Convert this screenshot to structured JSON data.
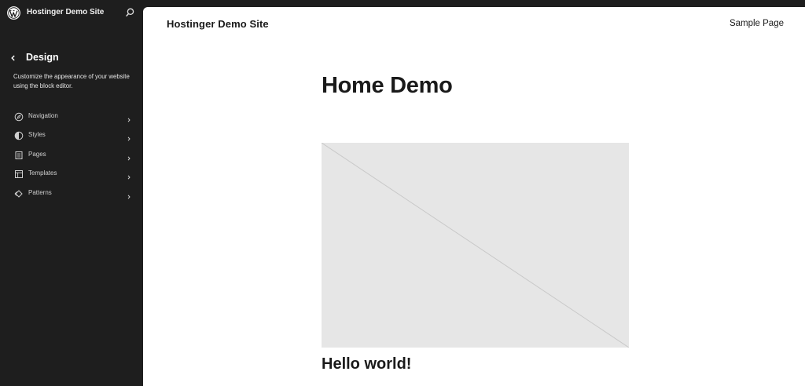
{
  "sidebar": {
    "site_title": "Hostinger Demo Site",
    "section_title": "Design",
    "description": "Customize the appearance of your website using the block editor.",
    "items": [
      {
        "label": "Navigation",
        "icon": "navigation-icon"
      },
      {
        "label": "Styles",
        "icon": "styles-icon"
      },
      {
        "label": "Pages",
        "icon": "pages-icon"
      },
      {
        "label": "Templates",
        "icon": "templates-icon"
      },
      {
        "label": "Patterns",
        "icon": "patterns-icon"
      }
    ]
  },
  "preview": {
    "site_title": "Hostinger Demo Site",
    "nav_link": "Sample Page",
    "page_heading": "Home Demo",
    "post_title": "Hello world!"
  },
  "colors": {
    "sidebar_bg": "#1e1e1e",
    "canvas_bg": "#ffffff",
    "placeholder_bg": "#e6e6e6"
  }
}
